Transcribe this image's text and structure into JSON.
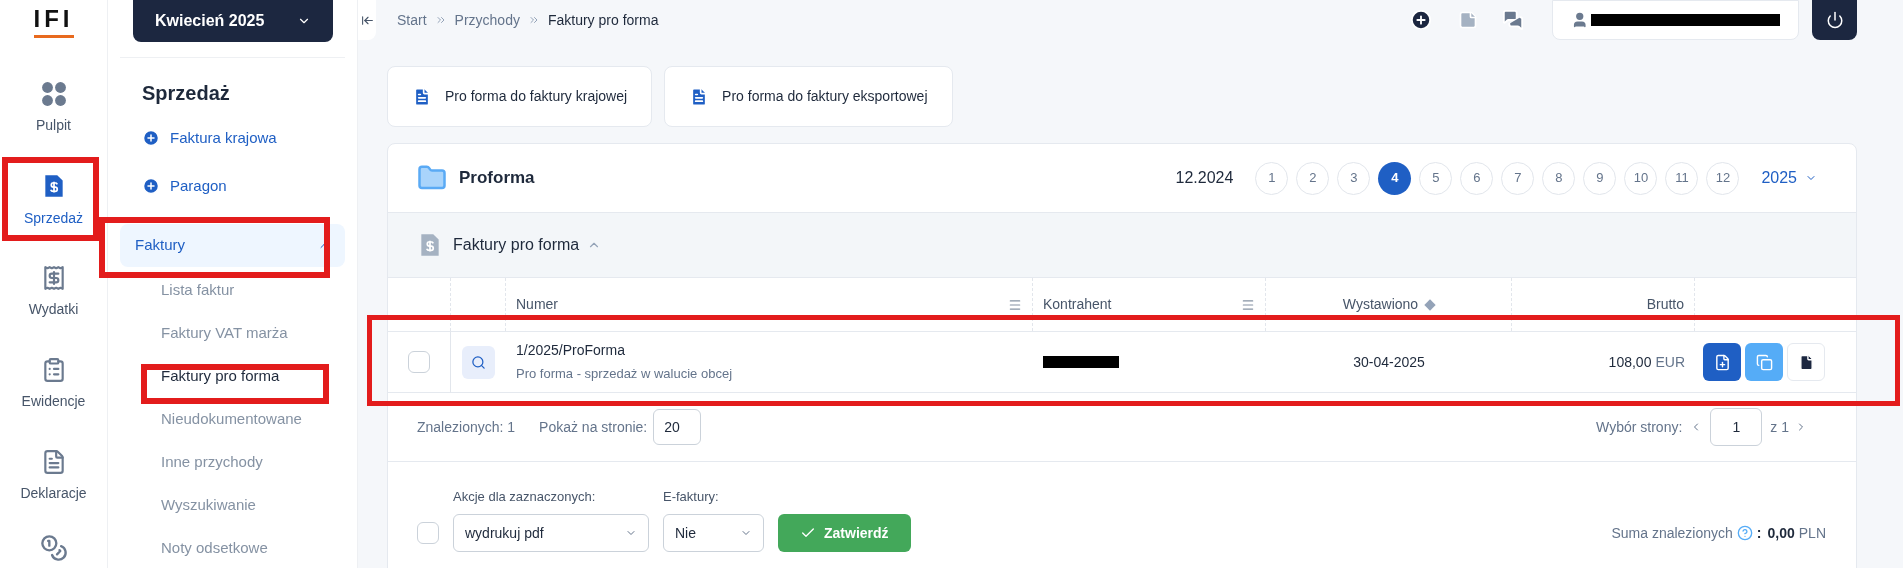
{
  "logo": "IFI",
  "rail": [
    {
      "label": "Pulpit",
      "selected": false
    },
    {
      "label": "Sprzedaż",
      "selected": true
    },
    {
      "label": "Wydatki",
      "selected": false
    },
    {
      "label": "Ewidencje",
      "selected": false
    },
    {
      "label": "Deklaracje",
      "selected": false
    }
  ],
  "period_button": "Kwiecień 2025",
  "section_title": "Sprzedaż",
  "quick_actions": [
    "Faktura krajowa",
    "Paragon"
  ],
  "menu": {
    "label": "Faktury",
    "expanded": true,
    "children": [
      {
        "label": "Lista faktur",
        "selected": false
      },
      {
        "label": "Faktury VAT marża",
        "selected": false
      },
      {
        "label": "Faktury pro forma",
        "selected": true
      },
      {
        "label": "Nieudokumentowane",
        "selected": false
      },
      {
        "label": "Inne przychody",
        "selected": false
      },
      {
        "label": "Wyszukiwanie",
        "selected": false
      },
      {
        "label": "Noty odsetkowe",
        "selected": false
      }
    ]
  },
  "breadcrumb": [
    "Start",
    "Przychody",
    "Faktury pro forma"
  ],
  "create_buttons": [
    "Pro forma do faktury krajowej",
    "Pro forma do faktury eksportowej"
  ],
  "panel": {
    "title": "Proforma",
    "previous_period": "12.2024",
    "year": "2025",
    "months": [
      {
        "label": "1",
        "selected": false
      },
      {
        "label": "2",
        "selected": false
      },
      {
        "label": "3",
        "selected": false
      },
      {
        "label": "4",
        "selected": true
      },
      {
        "label": "5",
        "selected": false
      },
      {
        "label": "6",
        "selected": false
      },
      {
        "label": "7",
        "selected": false
      },
      {
        "label": "8",
        "selected": false
      },
      {
        "label": "9",
        "selected": false
      },
      {
        "label": "10",
        "selected": false
      },
      {
        "label": "11",
        "selected": false
      },
      {
        "label": "12",
        "selected": false
      }
    ]
  },
  "section": {
    "title": "Faktury pro forma",
    "expanded": true
  },
  "table": {
    "columns": [
      "Numer",
      "Kontrahent",
      "Wystawiono",
      "Brutto"
    ],
    "rows": [
      {
        "checked": false,
        "number": "1/2025/ProForma",
        "description": "Pro forma - sprzedaż w walucie obcej",
        "issued": "30-04-2025",
        "amount": "108,00",
        "currency": "EUR"
      }
    ]
  },
  "pager": {
    "found": "Znalezionych: 1",
    "per_page_label": "Pokaż na stronie:",
    "per_page": "20",
    "page_label": "Wybór strony:",
    "page": "1",
    "of": "z 1"
  },
  "bulk": {
    "checked": false,
    "action_label": "Akcje dla zaznaczonych:",
    "action": "wydrukuj pdf",
    "einvoice_label": "E-faktury:",
    "einvoice": "Nie",
    "submit": "Zatwierdź"
  },
  "total": {
    "label": "Suma znalezionych",
    "separator": ":",
    "amount": "0,00",
    "currency": "PLN"
  }
}
